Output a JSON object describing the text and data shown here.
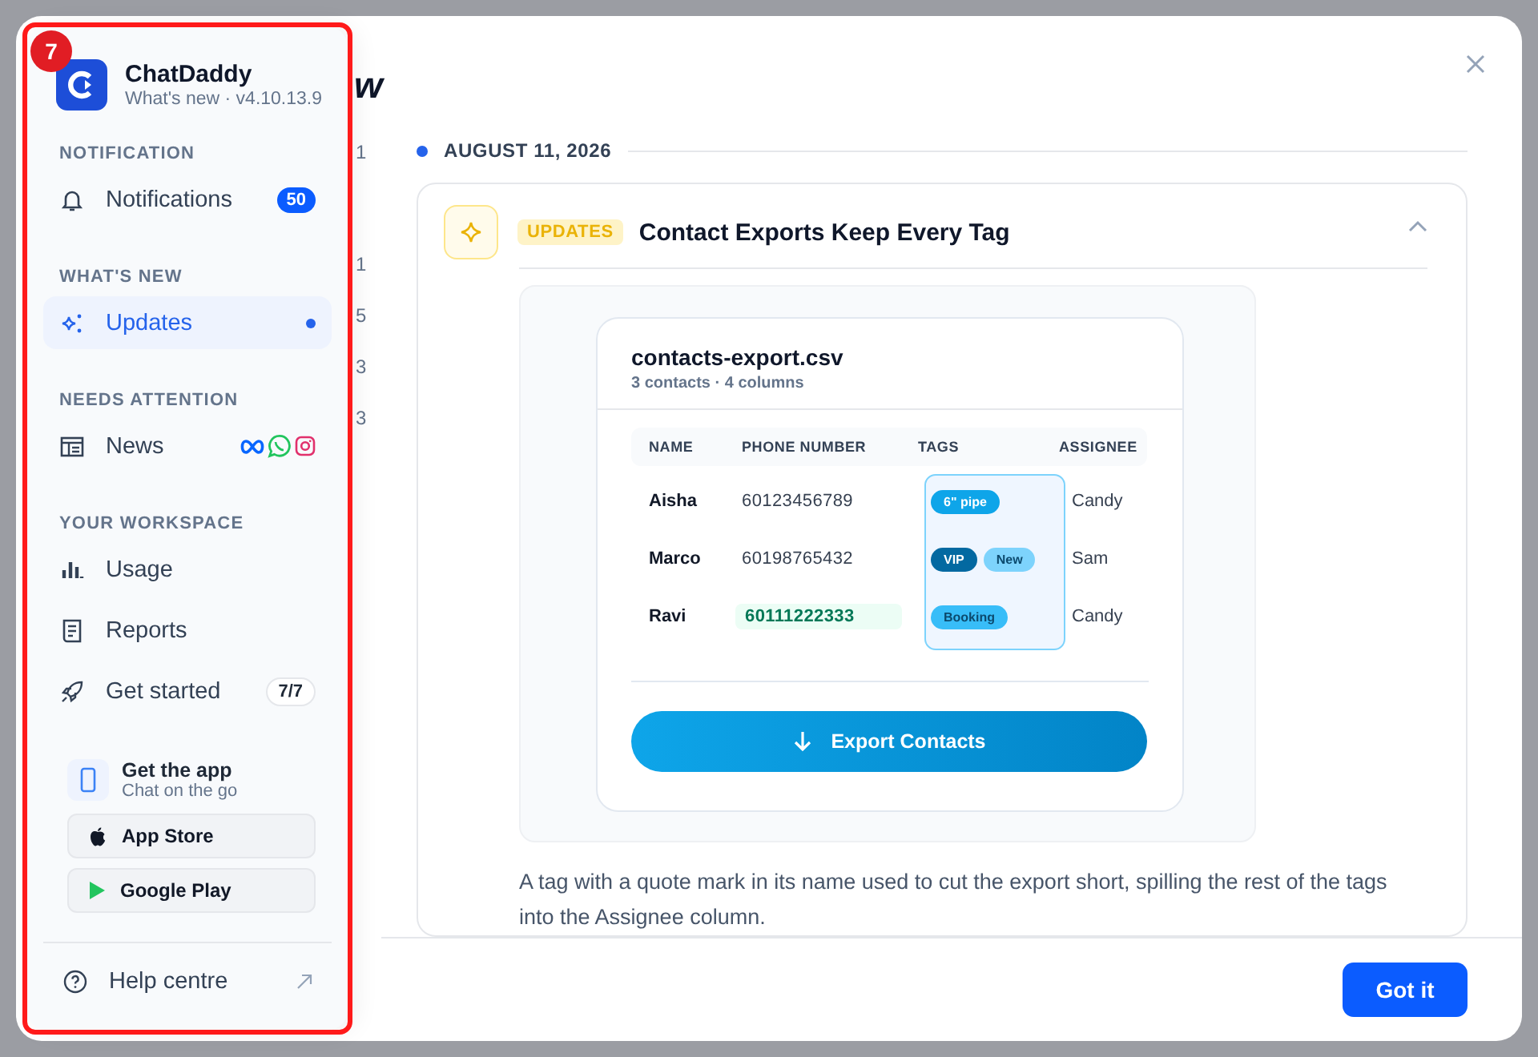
{
  "highlight": {
    "label": "7"
  },
  "behind_sidebar": {
    "title_fragment": "w",
    "list_fragments": [
      "1",
      "1",
      "5",
      "3",
      "3"
    ]
  },
  "sidebar": {
    "app_name": "ChatDaddy",
    "subtitle": "What's new · v4.10.13.9",
    "sections": [
      {
        "heading": "NOTIFICATION",
        "items": [
          {
            "label": "Notifications",
            "selected": false,
            "kind": "badge",
            "trailing": "50"
          }
        ]
      },
      {
        "heading": "WHAT'S NEW",
        "items": [
          {
            "label": "Updates",
            "selected": true,
            "kind": "dot"
          }
        ]
      },
      {
        "heading": "NEEDS ATTENTION",
        "items": [
          {
            "label": "News",
            "selected": false,
            "kind": "socials"
          }
        ]
      },
      {
        "heading": "YOUR WORKSPACE",
        "items": [
          {
            "label": "Usage",
            "selected": false,
            "kind": "plain"
          },
          {
            "label": "Reports",
            "selected": false,
            "kind": "plain"
          },
          {
            "label": "Get started",
            "selected": false,
            "kind": "count",
            "trailing": "7/7"
          }
        ]
      }
    ],
    "app_promo": {
      "title": "Get the app",
      "subtitle": "Chat on the go",
      "buttons": [
        {
          "label": "App Store",
          "kind": "apple"
        },
        {
          "label": "Google Play",
          "kind": "play"
        }
      ]
    },
    "help": {
      "label": "Help centre"
    }
  },
  "main": {
    "date": "AUGUST 11, 2026",
    "update": {
      "category": "UPDATES",
      "title": "Contact Exports Keep Every Tag",
      "expanded": true,
      "preview": {
        "file": "contacts-export.csv",
        "meta": "3 contacts · 4 columns",
        "columns": [
          "NAME",
          "PHONE NUMBER",
          "TAGS",
          "ASSIGNEE"
        ],
        "rows": [
          {
            "name": "Aisha",
            "phone": "60123456789",
            "highlighted": false,
            "tags": [
              {
                "label": "6\" pipe",
                "color": "#0ea5e9"
              }
            ],
            "assignee": "Candy"
          },
          {
            "name": "Marco",
            "phone": "60198765432",
            "highlighted": false,
            "tags": [
              {
                "label": "VIP",
                "color": "#0369a1"
              },
              {
                "label": "New",
                "color": "#7dd3fc"
              }
            ],
            "assignee": "Sam"
          },
          {
            "name": "Ravi",
            "phone": "60111222333",
            "highlighted": true,
            "tags": [
              {
                "label": "Booking",
                "color": "#38bdf8"
              }
            ],
            "assignee": "Candy"
          }
        ],
        "button": "Export Contacts"
      },
      "description": "A tag with a quote mark in its name used to cut the export short, spilling the rest of the tags into the Assignee column."
    }
  },
  "footer": {
    "button": "Got it"
  }
}
